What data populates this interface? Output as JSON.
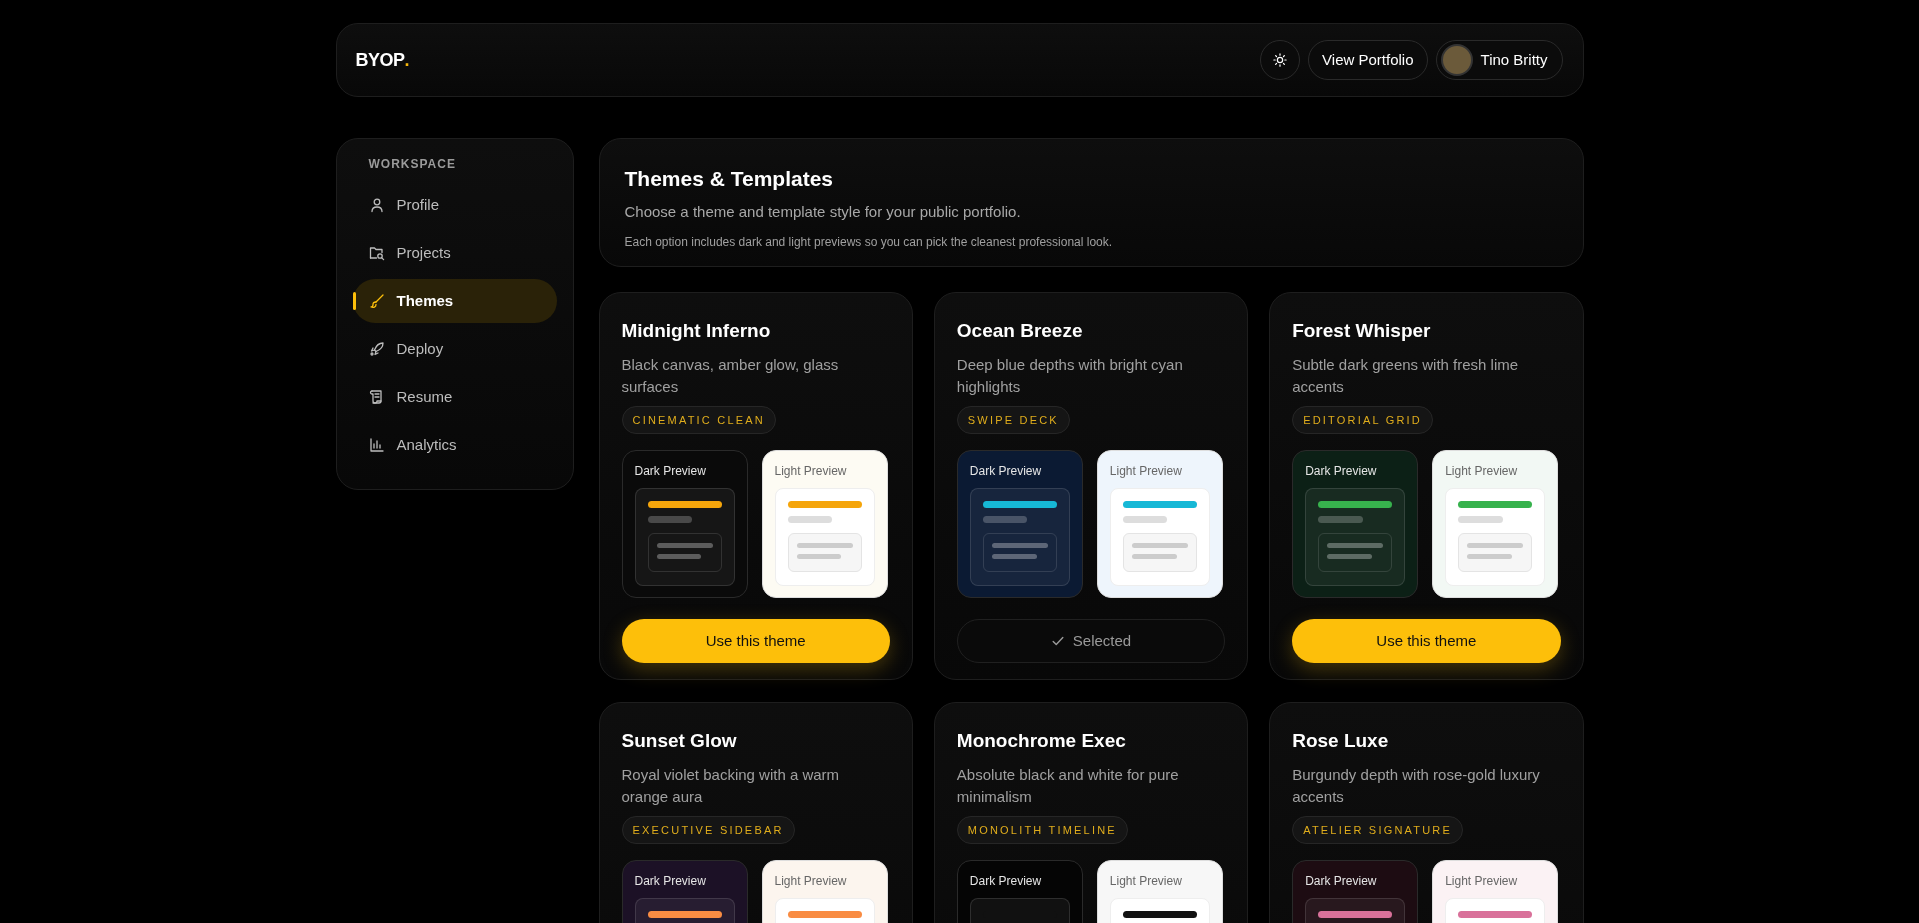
{
  "header": {
    "logo": "BYOP",
    "logo_mark": ".",
    "buttons": [
      {
        "kind": "icon"
      },
      {
        "kind": "text",
        "label": "View Portfolio"
      }
    ],
    "user": {
      "name": "Tino Britty"
    }
  },
  "sidebar": {
    "heading": "WORKSPACE",
    "items": [
      {
        "label": "Profile",
        "selected": false
      },
      {
        "label": "Projects",
        "selected": false
      },
      {
        "label": "Themes",
        "selected": true
      },
      {
        "label": "Deploy",
        "selected": false
      },
      {
        "label": "Resume",
        "selected": false
      },
      {
        "label": "Analytics",
        "selected": false
      }
    ]
  },
  "intro": {
    "title": "Themes & Templates",
    "subtitle": "Choose a theme and template style for your public portfolio.",
    "note": "Each option includes dark and light previews so you can pick the cleanest professional look."
  },
  "themes": [
    {
      "name": "Midnight Inferno",
      "description": "Black canvas, amber glow, glass surfaces",
      "template": "CINEMATIC CLEAN",
      "color": "#f5a50b",
      "previews": [
        {
          "kind": "dark",
          "label": "Dark Preview",
          "color": "#0a0a0a"
        },
        {
          "kind": "light",
          "label": "Light Preview",
          "color": "#fdfbf3"
        }
      ],
      "selected": false,
      "button": "Use this theme"
    },
    {
      "name": "Ocean Breeze",
      "description": "Deep blue depths with bright cyan highlights",
      "template": "SWIPE DECK",
      "color": "#16b8d6",
      "previews": [
        {
          "kind": "dark",
          "label": "Dark Preview",
          "color": "#0b1a33"
        },
        {
          "kind": "light",
          "label": "Light Preview",
          "color": "#eef5fc"
        }
      ],
      "selected": true,
      "button": "Selected"
    },
    {
      "name": "Forest Whisper",
      "description": "Subtle dark greens with fresh lime accents",
      "template": "EDITORIAL GRID",
      "color": "#37b24d",
      "previews": [
        {
          "kind": "dark",
          "label": "Dark Preview",
          "color": "#0c2016"
        },
        {
          "kind": "light",
          "label": "Light Preview",
          "color": "#f2f8f4"
        }
      ],
      "selected": false,
      "button": "Use this theme"
    },
    {
      "name": "Sunset Glow",
      "description": "Royal violet backing with a warm orange aura",
      "template": "EXECUTIVE SIDEBAR",
      "color": "#f98c43",
      "previews": [
        {
          "kind": "dark",
          "label": "Dark Preview",
          "color": "#1c1126"
        },
        {
          "kind": "light",
          "label": "Light Preview",
          "color": "#fcf5ee"
        }
      ]
    },
    {
      "name": "Monochrome Exec",
      "description": "Absolute black and white for pure minimalism",
      "template": "MONOLITH TIMELINE",
      "color": "#111111",
      "previews": [
        {
          "kind": "dark",
          "label": "Dark Preview",
          "color": "#050505"
        },
        {
          "kind": "light",
          "label": "Light Preview",
          "color": "#f7f7f7"
        }
      ]
    },
    {
      "name": "Rose Luxe",
      "description": "Burgundy depth with rose-gold luxury accents",
      "template": "ATELIER SIGNATURE",
      "color": "#d9719a",
      "previews": [
        {
          "kind": "dark",
          "label": "Dark Preview",
          "color": "#1d0c12"
        },
        {
          "kind": "light",
          "label": "Light Preview",
          "color": "#fbf2f4"
        }
      ]
    }
  ]
}
